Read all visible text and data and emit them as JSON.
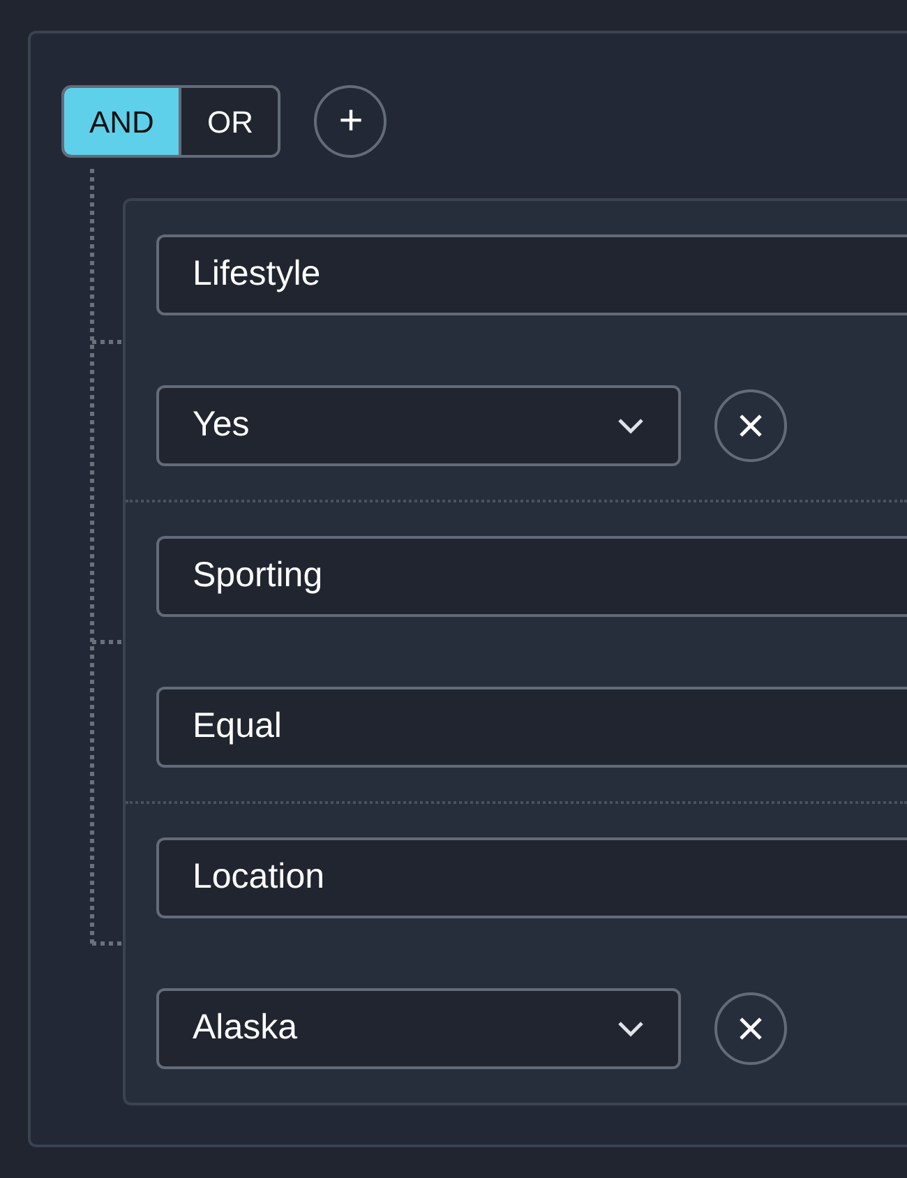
{
  "combinator": [
    {
      "label": "AND",
      "selected": true
    },
    {
      "label": "OR",
      "selected": false
    }
  ],
  "add_button": {
    "label": "+"
  },
  "rules": [
    {
      "field": "Lifestyle",
      "value": {
        "kind": "select",
        "text": "Yes"
      },
      "removable": true
    },
    {
      "field": "Sporting",
      "value": {
        "kind": "input",
        "text": "Equal"
      },
      "removable": false
    },
    {
      "field": "Location",
      "value": {
        "kind": "select",
        "text": "Alaska"
      },
      "removable": true
    }
  ]
}
